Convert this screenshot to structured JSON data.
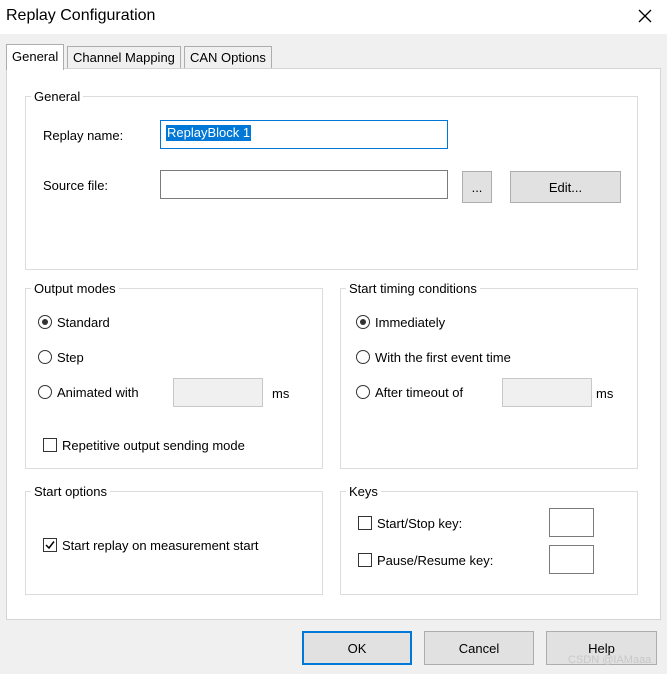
{
  "window": {
    "title": "Replay Configuration",
    "close_icon": "close-icon"
  },
  "tabs": [
    {
      "label": "General",
      "active": true
    },
    {
      "label": "Channel Mapping",
      "active": false
    },
    {
      "label": "CAN Options",
      "active": false
    }
  ],
  "general_group": {
    "label": "General",
    "replay_name_label": "Replay name:",
    "replay_name_value": "ReplayBlock 1",
    "source_file_label": "Source file:",
    "source_file_value": "",
    "browse_button": "...",
    "edit_button": "Edit..."
  },
  "output_modes": {
    "label": "Output modes",
    "standard": "Standard",
    "step": "Step",
    "animated_with": "Animated with",
    "animated_unit": "ms",
    "selected": "Standard",
    "repetitive_label": "Repetitive output sending mode",
    "repetitive_checked": false
  },
  "start_timing": {
    "label": "Start timing conditions",
    "immediately": "Immediately",
    "first_event": "With the first event time",
    "after_timeout": "After timeout of",
    "timeout_unit": "ms",
    "selected": "Immediately"
  },
  "start_options": {
    "label": "Start options",
    "start_replay_label": "Start replay on measurement start",
    "start_replay_checked": true
  },
  "keys": {
    "label": "Keys",
    "start_stop_label": "Start/Stop key:",
    "pause_resume_label": "Pause/Resume key:"
  },
  "footer": {
    "ok": "OK",
    "cancel": "Cancel",
    "help": "Help"
  },
  "watermark": "CSDN @IAMaaa"
}
